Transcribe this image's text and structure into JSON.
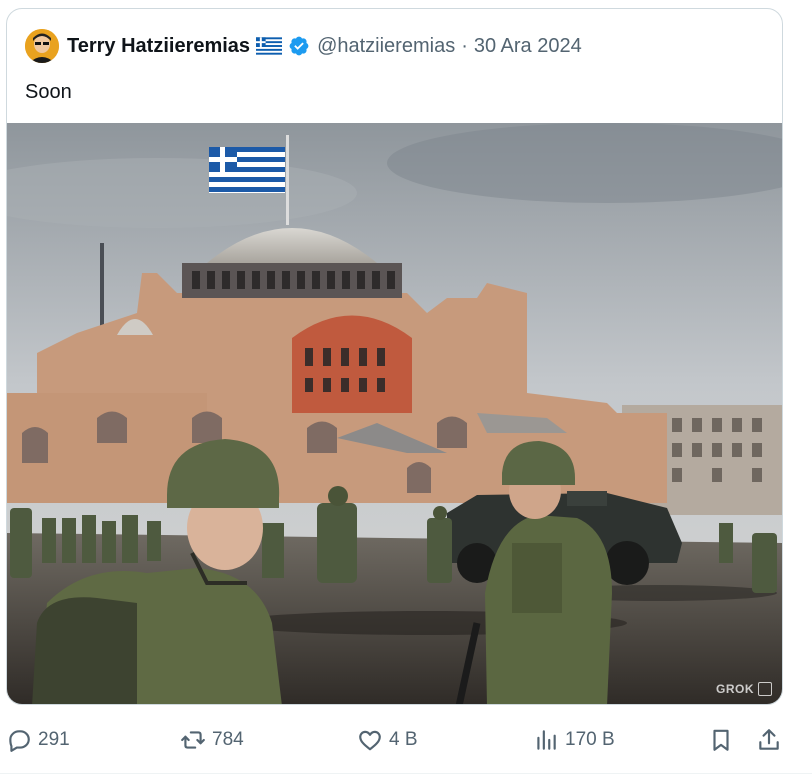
{
  "quoted_post": {
    "author_name": "Terry Hatziieremias",
    "handle": "@hatziieremias",
    "separator": "·",
    "date": "30 Ara 2024",
    "text": "Soon",
    "badges": [
      "greece-flag-icon",
      "verified-badge-icon"
    ],
    "media": {
      "watermark": "GROK"
    }
  },
  "actions": {
    "replies": "291",
    "reposts": "784",
    "likes": "4 B",
    "views": "170 B"
  },
  "colors": {
    "text_primary": "#0f1419",
    "text_secondary": "#536471",
    "verified_blue": "#1d9bf0",
    "border": "#cfd9de"
  }
}
